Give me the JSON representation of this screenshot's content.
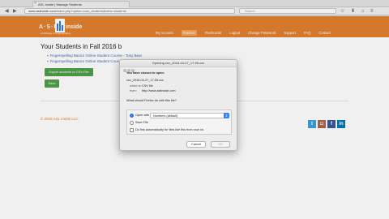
{
  "browser": {
    "tab_title": "ASL Inside | Manage Students",
    "tab_close": "×",
    "back_arrow": "◀",
    "forward_arrow": "▶",
    "url_host": "www.aslinside.com",
    "url_path": "/index.php?option=com_students&view=students",
    "search_placeholder": "Search",
    "tool_icons": "☆ ⬇ ⌂ ≡",
    "window_colors": [
      "#ff5f57",
      "#febc2e",
      "#28c840"
    ]
  },
  "site": {
    "logo_left": "A·S·L",
    "logo_right": "inside",
    "logo_tagline": "A Pathway to Fingerspelling",
    "menu": [
      "My Account",
      "Practice",
      "Flashcards",
      "Logout",
      "Change Password",
      "Support",
      "FAQ",
      "Contact"
    ],
    "active_menu_index": 1,
    "accent_color": "#e2802f"
  },
  "main": {
    "title": "Your Students in Fall 2016 b",
    "students": [
      "Fingerspelling Basics Online Student Course - Tony Bear",
      "Fingerspelling Basics Online Student Course - Sam Hack"
    ],
    "export_button": "Export students to CSV File",
    "save_button": "Save",
    "copyright": "© 2016 ASL Inside LLC",
    "social_icons": [
      {
        "name": "twitter-icon",
        "glyph": "t",
        "color": "#3ba0d9"
      },
      {
        "name": "instagram-icon",
        "glyph": "◘",
        "color": "#a9664e"
      },
      {
        "name": "facebook-icon",
        "glyph": "f",
        "color": "#3b5998"
      },
      {
        "name": "linkedin-icon",
        "glyph": "in",
        "color": "#0077b5"
      }
    ]
  },
  "dialog": {
    "title": "Opening csv_2016-04-27_17-55.csv",
    "intro": "You have chosen to open:",
    "filename": "csv_2016-04-27_17-55.csv",
    "which_is_label": "which is:",
    "which_is_value": "CSV file",
    "from_label": "from:",
    "from_value": "http://www.aslinside.com",
    "question": "What should Firefox do with this file?",
    "open_with_label": "Open with",
    "open_with_app": "Numbers (default)",
    "save_file_label": "Save File",
    "auto_label": "Do this automatically for files like this from now on.",
    "cancel_button": "Cancel",
    "ok_button": "OK"
  }
}
